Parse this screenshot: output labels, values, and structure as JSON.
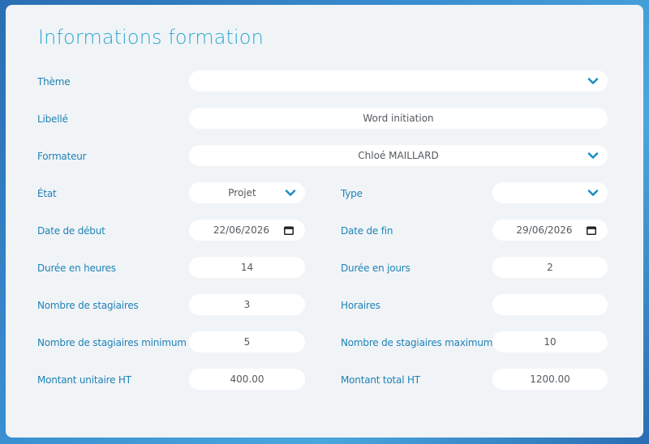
{
  "page": {
    "title": "Informations formation"
  },
  "labels": {
    "theme": "Thème",
    "libelle": "Libellé",
    "formateur": "Formateur",
    "etat": "État",
    "type": "Type",
    "date_debut": "Date de début",
    "date_fin": "Date de fin",
    "duree_heures": "Durée en heures",
    "duree_jours": "Durée en jours",
    "nb_stagiaires": "Nombre de stagiaires",
    "horaires": "Horaires",
    "nb_min": "Nombre de stagiaires minimum",
    "nb_max": "Nombre de stagiaires maximum",
    "montant_unitaire": "Montant unitaire HT",
    "montant_total": "Montant total HT"
  },
  "values": {
    "theme": "",
    "libelle": "Word initiation",
    "formateur": "Chloé MAILLARD",
    "etat": "Projet",
    "type": "",
    "date_debut": "22/06/2026",
    "date_fin": "29/06/2026",
    "duree_heures": "14",
    "duree_jours": "2",
    "nb_stagiaires": "3",
    "horaires": "",
    "nb_min": "5",
    "nb_max": "10",
    "montant_unitaire": "400.00",
    "montant_total": "1200.00"
  },
  "icons": {
    "dropdown": "chevron-down-icon",
    "date": "calendar-icon"
  },
  "colors": {
    "accent": "#1e82b6",
    "title": "#2aa8cf",
    "panel": "#f1f4f7",
    "field": "#ffffff"
  }
}
